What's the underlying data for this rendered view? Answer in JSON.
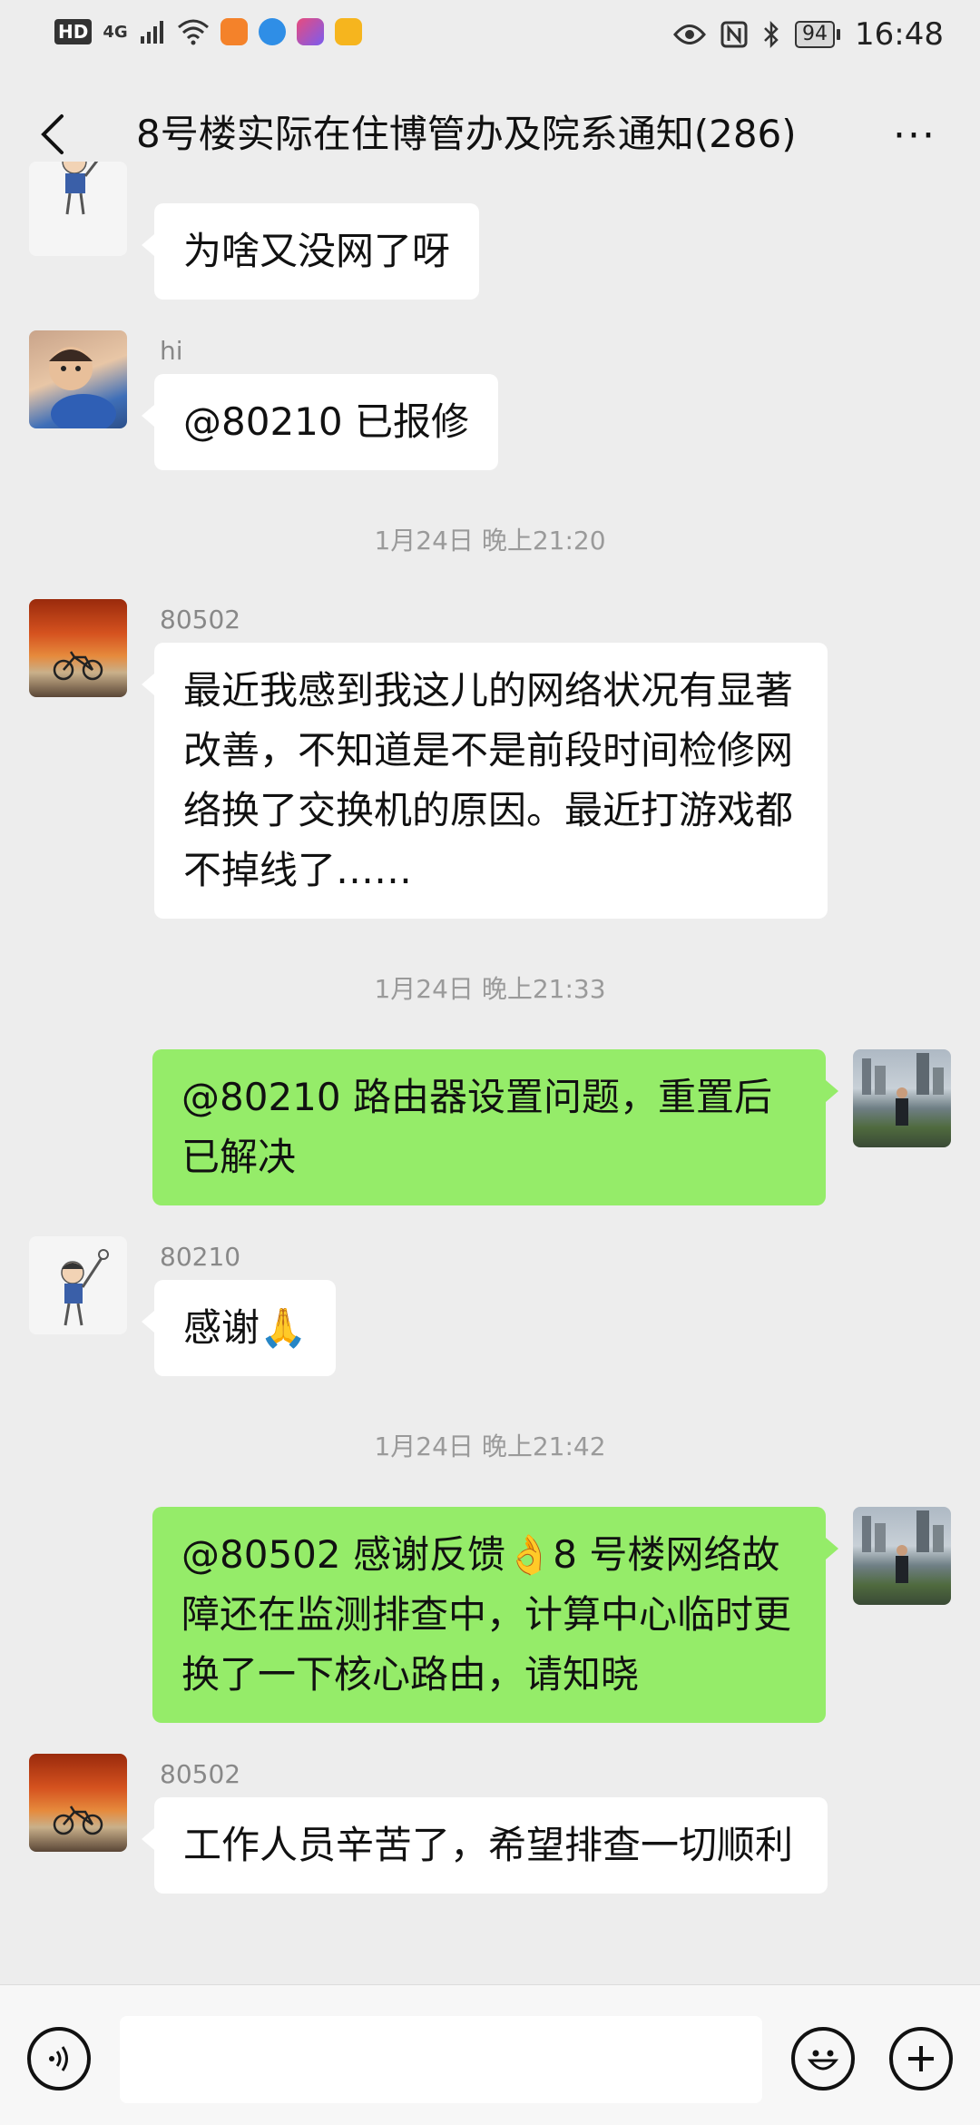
{
  "status_bar": {
    "hd": "HD",
    "network": "4G",
    "battery": "94",
    "time": "16:48"
  },
  "header": {
    "title": "8号楼实际在住博管办及院系通知(286)",
    "more": "···"
  },
  "messages": [
    {
      "sender": "",
      "text": "为啥又没网了呀"
    },
    {
      "sender": "hi",
      "text": "@80210  已报修"
    },
    {
      "timestamp": "1月24日 晚上21:20"
    },
    {
      "sender": "80502",
      "text": "最近我感到我这儿的网络状况有显著改善，不知道是不是前段时间检修网络换了交换机的原因。最近打游戏都不掉线了……"
    },
    {
      "timestamp": "1月24日 晚上21:33"
    },
    {
      "sender": "me",
      "text": "@80210 路由器设置问题，重置后已解决"
    },
    {
      "sender": "80210",
      "text": "感谢🙏"
    },
    {
      "timestamp": "1月24日 晚上21:42"
    },
    {
      "sender": "me",
      "text": "@80502  感谢反馈👌8 号楼网络故障还在监测排查中，计算中心临时更换了一下核心路由，请知晓"
    },
    {
      "sender": "80502",
      "text": "工作人员辛苦了，希望排查一切顺利"
    }
  ],
  "input": {
    "value": ""
  },
  "colors": {
    "background": "#ededed",
    "my_bubble": "#95ec69",
    "other_bubble": "#ffffff"
  },
  "icons": [
    "back-arrow-icon",
    "more-icon",
    "voice-icon",
    "emoji-icon",
    "plus-icon"
  ]
}
